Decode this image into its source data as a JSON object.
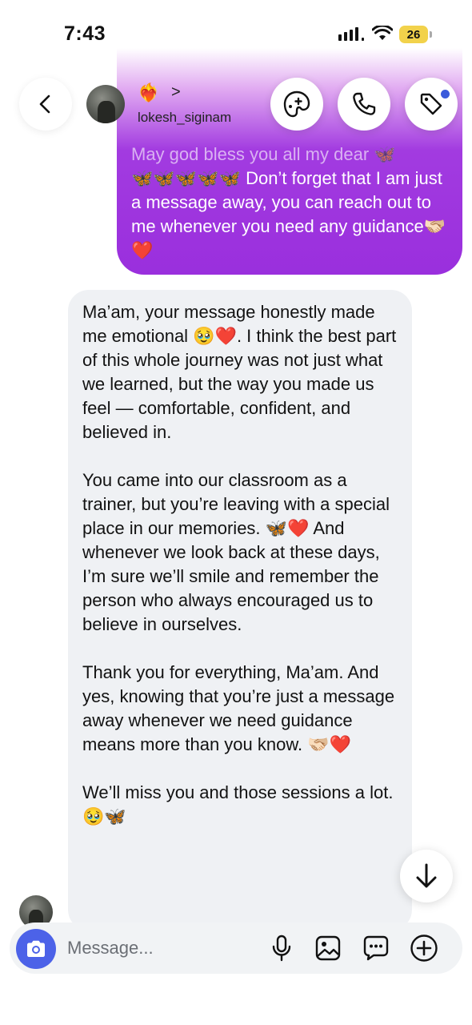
{
  "status_bar": {
    "time": "7:43",
    "battery": "26"
  },
  "header": {
    "profile_emoji": "❤️‍🔥",
    "chevron": ">",
    "username": "lokesh_siginam"
  },
  "messages": {
    "sent": {
      "text_faded": "May god bless you all my dear 🦋",
      "text": "\n🦋🦋🦋🦋🦋 Don’t forget that I am just a message away, you can reach out to me whenever you need any guidance🫱🏻‍🫲🏼❤️"
    },
    "received": {
      "text": "Ma’am, your message honestly made me emotional 🥹❤️. I think the best part of this whole journey was not just what we learned, but the way you made us feel — comfortable, confident, and believed in.\n\nYou came into our classroom as a trainer, but you’re leaving with a special place in our memories. 🦋❤️ And whenever we look back at these days, I’m sure we’ll smile and remember the person who always encouraged us to believe in ourselves.\n\nThank you for everything, Ma’am. And yes, knowing that you’re just a message away whenever we need guidance means more than you know. 🫱🏻‍🫲🏼❤️\n\nWe’ll miss you and those sessions a lot. 🥹🦋"
    }
  },
  "composer": {
    "placeholder": "Message..."
  },
  "colors": {
    "sent_bubble": "#9a2fdd",
    "received_bubble": "#eff1f4",
    "camera_button": "#4c62e8",
    "notify_dot": "#3b5bdb",
    "battery": "#f2d24b"
  },
  "icons": {
    "back": "chevron-left-icon",
    "effects": "sticker-effects-icon",
    "call": "phone-icon",
    "tag": "tag-icon",
    "scroll_down": "arrow-down-icon",
    "camera": "camera-icon",
    "mic": "microphone-icon",
    "gallery": "image-icon",
    "sticker": "chat-bubble-icon",
    "add": "plus-circle-icon"
  }
}
